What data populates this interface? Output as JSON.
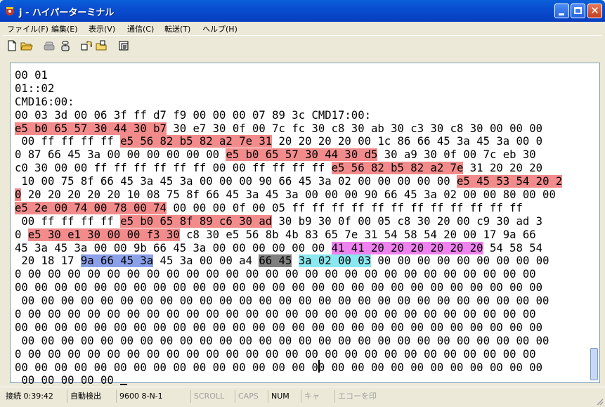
{
  "window": {
    "title": "j - ハイパーターミナル"
  },
  "menu": [
    "ファイル(F)",
    "編集(E)",
    "表示(V)",
    "通信(C)",
    "転送(T)",
    "ヘルプ(H)"
  ],
  "toolbar": [
    "new-document-icon",
    "open-folder-icon",
    "disconnect-phone-icon",
    "call-phone-icon",
    "send-file-icon",
    "receive-file-icon",
    "properties-icon"
  ],
  "terminal": {
    "lines": [
      [
        {
          "t": "00 01"
        }
      ],
      [
        {
          "t": "01::02"
        }
      ],
      [
        {
          "t": "CMD16:00:"
        }
      ],
      [
        {
          "t": "00 03 3d 00 06 3f ff d7 f9 00 00 00 07 89 3c CMD17:00:"
        }
      ],
      [
        {
          "t": "e5 b0 65 57 30 44 30 b7",
          "h": "red"
        },
        {
          "t": " 30 e7 30 0f 00 7c fc 30 c8 30 ab 30 c3 30 c8 30 00 00 00"
        }
      ],
      [
        {
          "t": " 00 ff ff ff ff "
        },
        {
          "t": "e5 56 82 b5 82 a2 7e 31",
          "h": "red"
        },
        {
          "t": " 20 20 20 20 00 1c 86 66 45 3a 45 3a 00 0"
        }
      ],
      [
        {
          "t": "0 87 66 45 3a 00 00 00 00 00 00 "
        },
        {
          "t": "e5 b0 65 57 30 44 30 d5",
          "h": "red"
        },
        {
          "t": " 30 a9 30 0f 00 7c eb 30"
        }
      ],
      [
        {
          "t": "c0 30 00 00 ff ff ff ff ff ff 00 00 ff ff ff ff "
        },
        {
          "t": "e5 56 82 b5 82 a2 7e",
          "h": "red"
        },
        {
          "t": " 31 20 20 20"
        }
      ],
      [
        {
          "t": " 10 00 75 8f 66 45 3a 45 3a 00 00 00 90 66 45 3a 02 00 00 00 00 00 "
        },
        {
          "t": "e5 45 53 54 20 2",
          "h": "red"
        }
      ],
      [
        {
          "t": "0",
          "h": "red"
        },
        {
          "t": " 20 20 20 20 20 10 08 75 8f 66 45 3a 45 3a 00 00 00 90 66 45 3a 02 00 00 80 00 00"
        }
      ],
      [
        {
          "t": "e5 2e 00 74 00 78 00 74",
          "h": "red"
        },
        {
          "t": " 00 00 00 0f 00 05 ff ff ff ff ff ff ff ff ff ff ff ff"
        }
      ],
      [
        {
          "t": " 00 ff ff ff ff "
        },
        {
          "t": "e5 b0 65 8f 89 c6 30 ad",
          "h": "red"
        },
        {
          "t": " 30 b9 30 0f 00 05 c8 30 20 00 c9 30 ad 3"
        }
      ],
      [
        {
          "t": "0 "
        },
        {
          "t": "e5 30 e1 30 00 00 f3 30",
          "h": "red"
        },
        {
          "t": " c8 30 e5 56 8b 4b 83 65 7e 31 54 58 54 20 00 17 9a 66"
        }
      ],
      [
        {
          "t": "45 3a 45 3a 00 00 9b 66 45 3a 00 00 00 00 00 00 "
        },
        {
          "t": "41 41 20 20 20 20 20 20",
          "h": "mag"
        },
        {
          "t": " 54 58 54"
        }
      ],
      [
        {
          "t": " 20 18 17 "
        },
        {
          "t": "9a 66 45 3a",
          "h": "blu"
        },
        {
          "t": " 45 3a 00 00 a4 "
        },
        {
          "t": "66 45",
          "h": "gry"
        },
        {
          "t": " "
        },
        {
          "t": "3a 02 00 03",
          "h": "cyn"
        },
        {
          "t": " 00 00 00 00 00 00 00 00 00"
        }
      ],
      [
        {
          "t": "0 00 00 00 00 00 00 00 00 00 00 00 00 00 00 00 00 00 00 00 00 00 00 00 00 00 00"
        }
      ],
      [
        {
          "t": "00 00 00 00 00 00 00 00 00 00 00 00 00 00 00 00 00 00 00 00 00 00 00 00 00 00 00"
        }
      ],
      [
        {
          "t": " 00 00 00 00 00 00 00 00 00 00 00 00 00 00 00 00 00 00 00 00 00 00 00 00 00 00 00"
        }
      ],
      [
        {
          "t": "0 00 00 00 00 00 00 00 00 00 00 00 00 00 00 00 00 00 00 00 00 00 00 00 00 00 00"
        }
      ],
      [
        {
          "t": "00 00 00 00 00 00 00 00 00 00 00 00 00 00 00 00 00 00 00 00 00 00 00 00 00 00 00"
        }
      ],
      [
        {
          "t": " 00 00 00 00 00 00 00 00 00 00 00 00 00 00 00 00 00 00 00 00 00 00 00 00 00 00 00"
        }
      ],
      [
        {
          "t": "0 00 00 00 00 00 00 00 00 00 00 00 00 00 00 00 00 00 00 00 00 00 00 00 00 00 00"
        }
      ],
      [
        {
          "t": "00 00 00 00 00 00 00 00 00 00 00 00 00 00 00 00 00 00 00 00 00 00 00 00 00 00 00"
        }
      ],
      [
        {
          "t": " 00 00 00 00 00 "
        }
      ]
    ]
  },
  "status": [
    {
      "text": "接続 0:39:42",
      "dim": false
    },
    {
      "text": "自動検出",
      "dim": false
    },
    {
      "text": "9600 8-N-1",
      "dim": false
    },
    {
      "text": "SCROLL",
      "dim": true
    },
    {
      "text": "CAPS",
      "dim": true
    },
    {
      "text": "NUM",
      "dim": false
    },
    {
      "text": "キャ",
      "dim": true
    },
    {
      "text": "エコーを印",
      "dim": true
    }
  ],
  "colors": {
    "red": "#f28b8b",
    "magenta": "#ee82ee",
    "blue": "#8aa0e8",
    "gray": "#7f7f7f",
    "cyan": "#8ae8f0"
  }
}
